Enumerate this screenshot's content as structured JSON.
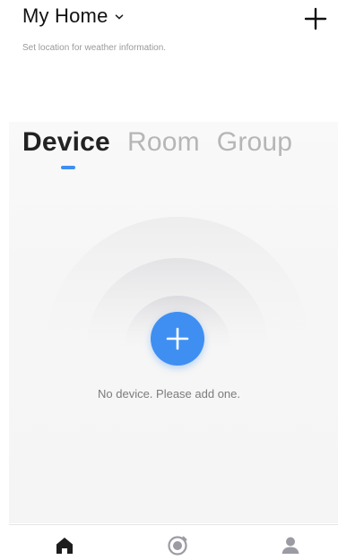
{
  "header": {
    "title": "My Home",
    "subtitle": "Set location for weather information.",
    "add_icon": "plus-icon"
  },
  "tabs": [
    {
      "label": "Device",
      "active": true
    },
    {
      "label": "Room",
      "active": false
    },
    {
      "label": "Group",
      "active": false
    }
  ],
  "empty_state": {
    "message": "No device. Please add one.",
    "add_icon": "plus-icon"
  },
  "bottom_nav": [
    {
      "icon": "home-icon",
      "active": true
    },
    {
      "icon": "smart-scene-icon",
      "active": false
    },
    {
      "icon": "profile-icon",
      "active": false
    }
  ],
  "colors": {
    "accent": "#3f8ff2",
    "text_primary": "#111111",
    "text_muted": "#9a9a9a",
    "tab_inactive": "#b6b6b6",
    "panel_bg": "#f6f6f6"
  }
}
